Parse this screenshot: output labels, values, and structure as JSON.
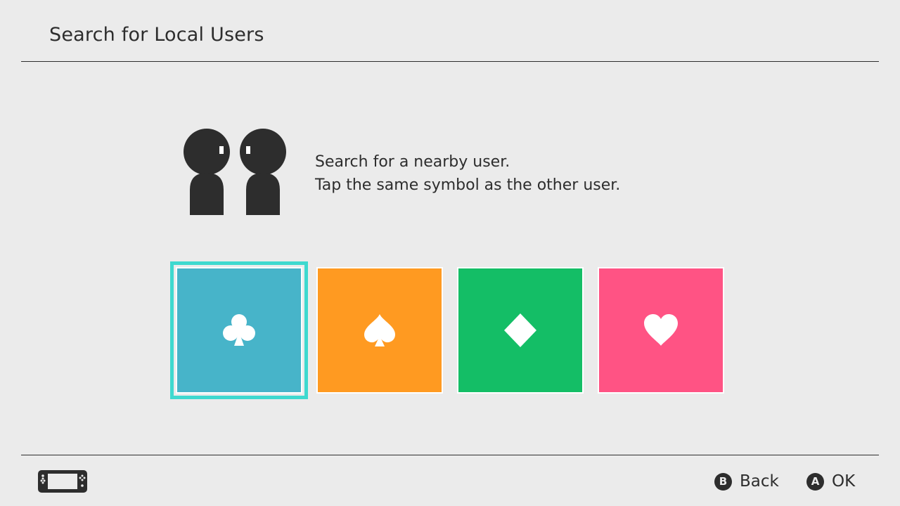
{
  "header": {
    "title": "Search for Local Users"
  },
  "instructions": {
    "line1": "Search for a nearby user.",
    "line2": "Tap the same symbol as the other user."
  },
  "tiles": [
    {
      "name": "club",
      "icon": "club-icon",
      "color": "#47b4c9",
      "selected": true
    },
    {
      "name": "spade",
      "icon": "spade-icon",
      "color": "#ff9a21",
      "selected": false
    },
    {
      "name": "diamond",
      "icon": "diamond-icon",
      "color": "#14be66",
      "selected": false
    },
    {
      "name": "heart",
      "icon": "heart-icon",
      "color": "#ff5384",
      "selected": false
    }
  ],
  "colors": {
    "background": "#ebebeb",
    "text": "#2d2d2d",
    "selection": "#3fd9cf"
  },
  "footer": {
    "back": {
      "glyph": "B",
      "label": "Back"
    },
    "ok": {
      "glyph": "A",
      "label": "OK"
    }
  }
}
